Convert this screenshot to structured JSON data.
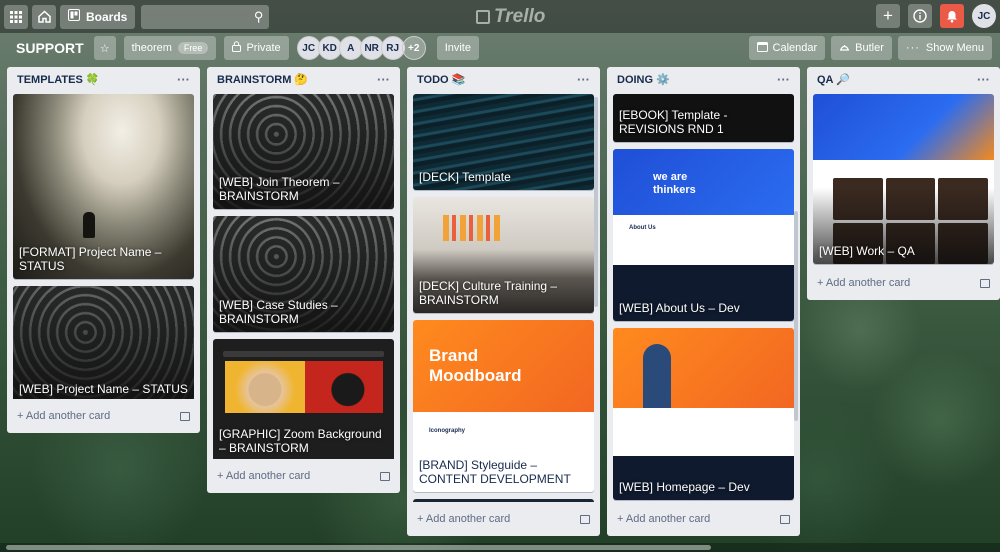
{
  "app": {
    "logo": "Trello"
  },
  "topbar": {
    "boards_label": "Boards",
    "search_value": "",
    "user_initials": "JC"
  },
  "board": {
    "title": "SUPPORT",
    "workspace": "theorem",
    "workspace_badge": "Free",
    "visibility": "Private",
    "members": [
      "JC",
      "KD",
      "A",
      "NR",
      "RJ"
    ],
    "more_members": "+2",
    "invite": "Invite",
    "calendar": "Calendar",
    "butler": "Butler",
    "show_menu": "Show Menu"
  },
  "lists": [
    {
      "title": "TEMPLATES 🍀",
      "add_card": "Add another card",
      "cards": [
        {
          "title": "[FORMAT] Project Name – STATUS"
        },
        {
          "title": "[WEB] Project Name – STATUS"
        }
      ]
    },
    {
      "title": "BRAINSTORM 🤔",
      "add_card": "Add another card",
      "cards": [
        {
          "title": "[WEB] Join Theorem – BRAINSTORM"
        },
        {
          "title": "[WEB] Case Studies – BRAINSTORM"
        },
        {
          "title": "[GRAPHIC] Zoom Background – BRAINSTORM"
        }
      ]
    },
    {
      "title": "TODO 📚",
      "add_card": "Add another card",
      "cards": [
        {
          "title": "[DECK] Template"
        },
        {
          "title": "[DECK] Culture Training – BRAINSTORM"
        },
        {
          "title": "[BRAND] Styleguide – CONTENT DEVELOPMENT",
          "cover_heading": "Brand Moodboard",
          "cover_sub": "Iconography"
        }
      ]
    },
    {
      "title": "DOING ⚙️",
      "add_card": "Add another card",
      "cards": [
        {
          "title": "[EBOOK] Template - REVISIONS RND 1"
        },
        {
          "title": "[WEB] About Us – Dev",
          "cover_heading": "we are thinkers",
          "cover_sub": "About Us"
        },
        {
          "title": "[WEB] Homepage – Dev"
        }
      ]
    },
    {
      "title": "QA 🔎",
      "add_card": "Add another card",
      "cards": [
        {
          "title": "[WEB] Work – QA"
        }
      ]
    }
  ]
}
